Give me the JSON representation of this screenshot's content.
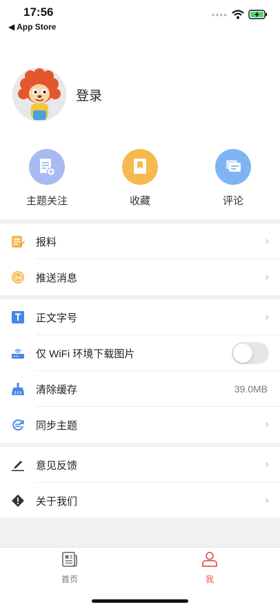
{
  "status": {
    "time": "17:56",
    "back_app": "◀ App Store"
  },
  "profile": {
    "login_label": "登录"
  },
  "quick_actions": [
    {
      "label": "主题关注",
      "color": "#A9B9F2",
      "icon": "document-plus-icon"
    },
    {
      "label": "收藏",
      "color": "#F6B94E",
      "icon": "bookmark-icon"
    },
    {
      "label": "评论",
      "color": "#7FB4F4",
      "icon": "comment-icon"
    }
  ],
  "menu": {
    "report": "报料",
    "push": "推送消息",
    "font_size": "正文字号",
    "wifi_images": "仅 WiFi 环境下载图片",
    "clear_cache": "清除缓存",
    "cache_size": "39.0MB",
    "sync_topics": "同步主题",
    "feedback": "意见反馈",
    "about": "关于我们"
  },
  "toggles": {
    "wifi_images_on": false
  },
  "tabs": [
    {
      "label": "首页",
      "active": false
    },
    {
      "label": "我",
      "active": true
    }
  ],
  "colors": {
    "accent": "#E0595A",
    "inactive_tab": "#777777"
  }
}
